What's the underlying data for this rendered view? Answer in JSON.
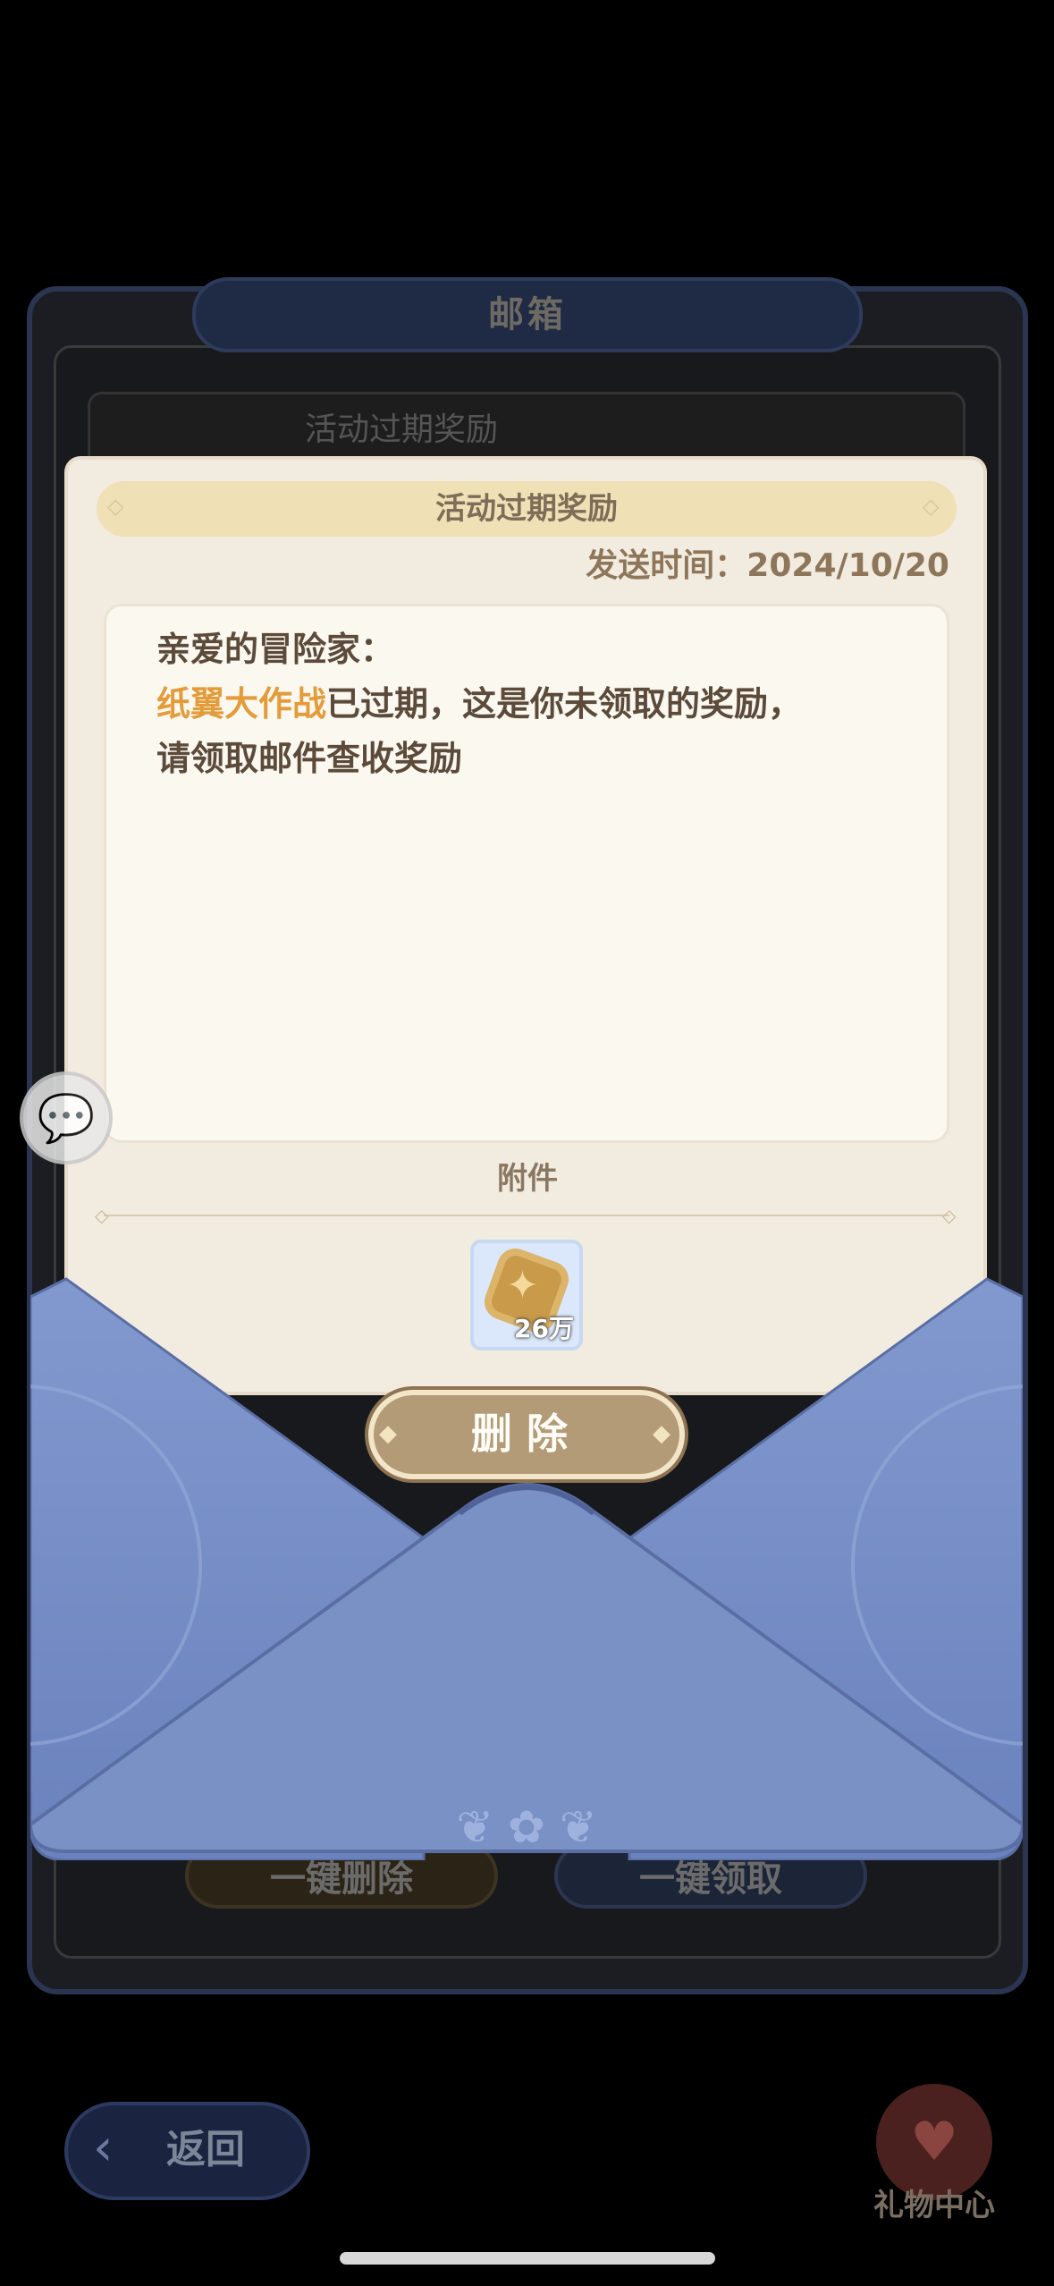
{
  "mailbox": {
    "title": "邮箱",
    "behind_item_title": "活动过期奖励",
    "delete_all_label": "一键删除",
    "claim_all_label": "一键领取"
  },
  "letter": {
    "title": "活动过期奖励",
    "send_time": "发送时间：2024/10/20",
    "greeting": "亲爱的冒险家：",
    "event_name": "纸翼大作战",
    "line2_rest": "已过期，这是你未领取的奖励，",
    "line3": "请领取邮件查收奖励",
    "attachment_label": "附件",
    "reward": {
      "icon": "gold-coin-icon",
      "amount": "26万"
    },
    "delete_button_label": "删除"
  },
  "footer": {
    "back_label": "返回",
    "gift_center_label": "礼物中心"
  },
  "colors": {
    "highlight": "#e49b3a",
    "envelope": "#7a91c6",
    "button": "#b29b76"
  }
}
